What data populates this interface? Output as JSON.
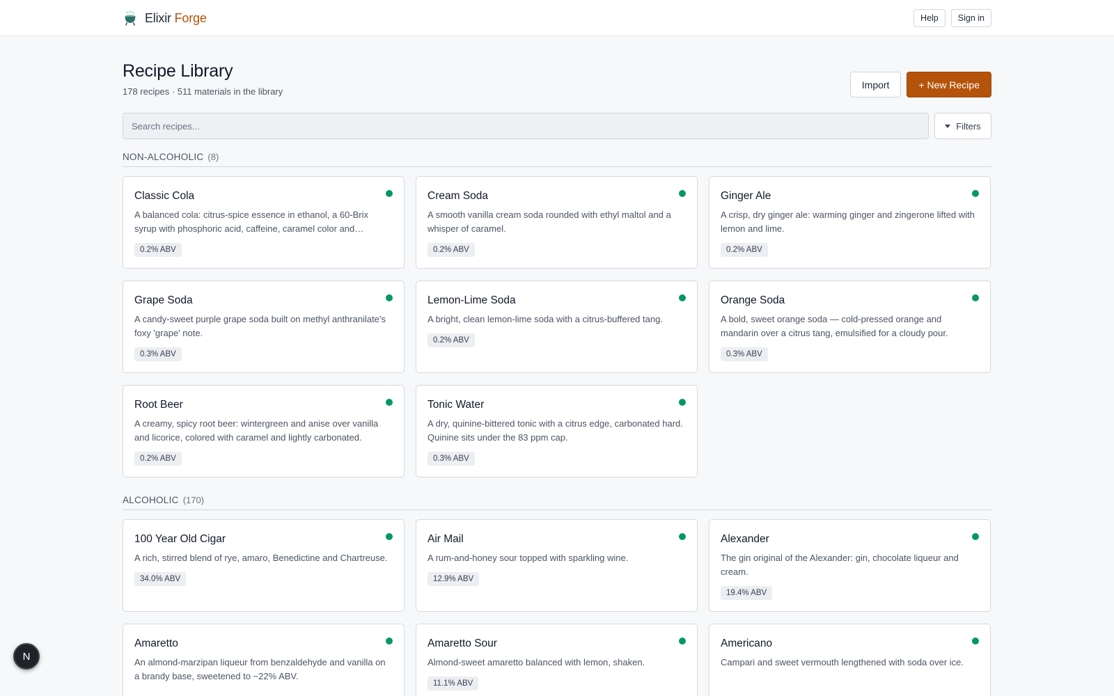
{
  "app": {
    "brand_primary": "Elixir",
    "brand_accent": "Forge",
    "help_label": "Help",
    "signin_label": "Sign in"
  },
  "page": {
    "title": "Recipe Library",
    "subtitle": "178 recipes · 511 materials in the library",
    "import_label": "Import",
    "new_recipe_label": "+ New Recipe",
    "search_placeholder": "Search recipes...",
    "filters_label": "Filters"
  },
  "sections": [
    {
      "title": "NON-ALCOHOLIC",
      "count": "(8)",
      "recipes": [
        {
          "name": "Classic Cola",
          "description": "A balanced cola: citrus-spice essence in ethanol, a 60-Brix syrup with phosphoric acid, caffeine, caramel color and carbonation.",
          "abv": "0.2% ABV"
        },
        {
          "name": "Cream Soda",
          "description": "A smooth vanilla cream soda rounded with ethyl maltol and a whisper of caramel.",
          "abv": "0.2% ABV"
        },
        {
          "name": "Ginger Ale",
          "description": "A crisp, dry ginger ale: warming ginger and zingerone lifted with lemon and lime.",
          "abv": "0.2% ABV"
        },
        {
          "name": "Grape Soda",
          "description": "A candy-sweet purple grape soda built on methyl anthranilate's foxy 'grape' note.",
          "abv": "0.3% ABV"
        },
        {
          "name": "Lemon-Lime Soda",
          "description": "A bright, clean lemon-lime soda with a citrus-buffered tang.",
          "abv": "0.2% ABV"
        },
        {
          "name": "Orange Soda",
          "description": "A bold, sweet orange soda — cold-pressed orange and mandarin over a citrus tang, emulsified for a cloudy pour.",
          "abv": "0.3% ABV"
        },
        {
          "name": "Root Beer",
          "description": "A creamy, spicy root beer: wintergreen and anise over vanilla and licorice, colored with caramel and lightly carbonated.",
          "abv": "0.2% ABV"
        },
        {
          "name": "Tonic Water",
          "description": "A dry, quinine-bittered tonic with a citrus edge, carbonated hard. Quinine sits under the 83 ppm cap.",
          "abv": "0.3% ABV"
        }
      ]
    },
    {
      "title": "ALCOHOLIC",
      "count": "(170)",
      "recipes": [
        {
          "name": "100 Year Old Cigar",
          "description": "A rich, stirred blend of rye, amaro, Benedictine and Chartreuse.",
          "abv": "34.0% ABV"
        },
        {
          "name": "Air Mail",
          "description": "A rum-and-honey sour topped with sparkling wine.",
          "abv": "12.9% ABV"
        },
        {
          "name": "Alexander",
          "description": "The gin original of the Alexander: gin, chocolate liqueur and cream.",
          "abv": "19.4% ABV"
        },
        {
          "name": "Amaretto",
          "description": "An almond-marzipan liqueur from benzaldehyde and vanilla on a brandy base, sweetened to ~22% ABV.",
          "abv": ""
        },
        {
          "name": "Amaretto Sour",
          "description": "Almond-sweet amaretto balanced with lemon, shaken.",
          "abv": "11.1% ABV"
        },
        {
          "name": "Americano",
          "description": "Campari and sweet vermouth lengthened with soda over ice.",
          "abv": ""
        }
      ]
    }
  ],
  "corner_badge": "N",
  "colors": {
    "accent": "#b45309",
    "status_ok": "#059669"
  }
}
